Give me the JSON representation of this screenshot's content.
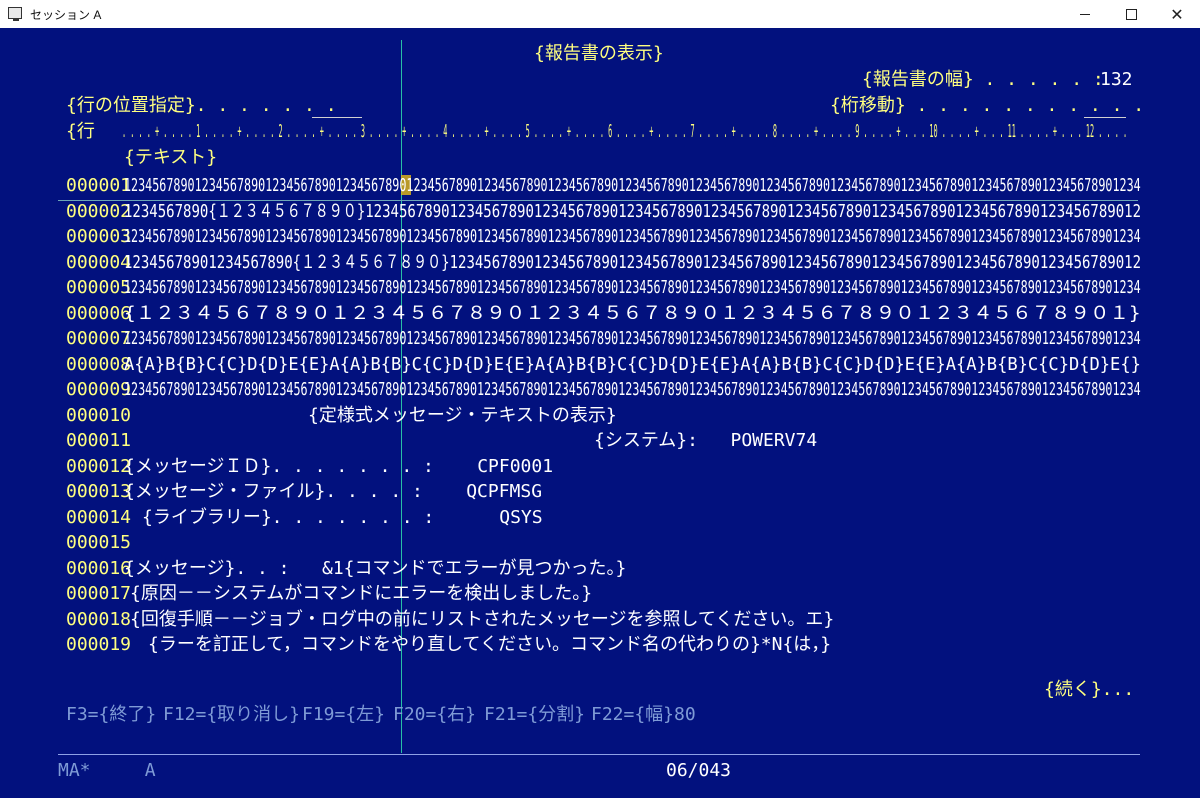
{
  "window": {
    "title": "セッション A",
    "minimize": "–",
    "maximize": "□",
    "close": "✕"
  },
  "screen": {
    "title": "{報告書の表示}",
    "report_width_label": "{報告書の幅} . . . . . :",
    "report_width_value": "132",
    "line_position_label": "{行の位置指定}. . . . . . .",
    "column_shift_label": "{桁移動} . . . . . . . . . . .",
    "ruler_label": "{行",
    "ruler": ". . . . + . . . . 1 . . . . + . . . . 2 . . . . + . . . . 3 . . . . + . . . . 4 . . . . + . . . . 5 . . . . + . . . . 6 . . . . + . . . . 7 . . . . + . . . . 8 . . . . + . . . . 9 . . . . + . . . 10 . . . . + . . . 11 . . . . + . . . 12 . . . .",
    "text_header": "{テキスト}",
    "lines": [
      {
        "num": "000001",
        "text": "123456789012345678901234567890123456789012345678901234567890123456789012345678901234567890123456789012345678901234567890123456789012345678901234"
      },
      {
        "num": "000002",
        "text": "1234567890{１２３４５６７８９０}12345678901234567890123456789012345678901234567890123456789012345678901234567890123456789012"
      },
      {
        "num": "000003",
        "text": "123456789012345678901234567890123456789012345678901234567890123456789012345678901234567890123456789012345678901234567890123456789012345678901234"
      },
      {
        "num": "000004",
        "text": "12345678901234567890{１２３４５６７８９０}1234567890123456789012345678901234567890123456789012345678901234567890123456789012"
      },
      {
        "num": "000005",
        "text": "123456789012345678901234567890123456789012345678901234567890123456789012345678901234567890123456789012345678901234567890123456789012345678901234"
      },
      {
        "num": "000006",
        "text": "{１２３４５６７８９０１２３４５６７８９０１２３４５６７８９０１２３４５６７８９０１２３４５６７８９０１}"
      },
      {
        "num": "000007",
        "text": "123456789012345678901234567890123456789012345678901234567890123456789012345678901234567890123456789012345678901234567890123456789012345678901234"
      },
      {
        "num": "000008",
        "text": "A{A}B{B}C{C}D{D}E{E}A{A}B{B}C{C}D{D}E{E}A{A}B{B}C{C}D{D}E{E}A{A}B{B}C{C}D{D}E{E}A{A}B{B}C{C}D{D}E{}"
      },
      {
        "num": "000009",
        "text": "123456789012345678901234567890123456789012345678901234567890123456789012345678901234567890123456789012345678901234567890123456789012345678901234"
      },
      {
        "num": "000010",
        "text": "{定様式メッセージ・テキストの表示}"
      },
      {
        "num": "000011",
        "text": "{システム}:   POWERV74"
      },
      {
        "num": "000012",
        "text": "{メッセージＩＤ}. . . . . . . :    CPF0001"
      },
      {
        "num": "000013",
        "text": "{メッセージ・ファイル}. . . . :    QCPFMSG"
      },
      {
        "num": "000014",
        "text": "{ライブラリー}. . . . . . . :      QSYS"
      },
      {
        "num": "000015",
        "text": ""
      },
      {
        "num": "000016",
        "text": "{メッセージ}. . :   &1{コマンドでエラーが見つかった。}"
      },
      {
        "num": "000017",
        "text": "{原因－－システムがコマンドにエラーを検出しました。}"
      },
      {
        "num": "000018",
        "text": "{回復手順－－ジョブ・ログ中の前にリストされたメッセージを参照してください。エ}"
      },
      {
        "num": "000019",
        "text": "{ラーを訂正して，コマンドをやり直してください。コマンド名の代わりの}*N{は，}"
      }
    ],
    "more": "{続く}...",
    "fkeys": [
      "F3={終了}",
      "F12={取り消し}",
      "F19={左}",
      "F20={右}",
      "F21={分割}",
      "F22={幅}80"
    ]
  },
  "status": {
    "left": "MA*     A",
    "position": "06/043"
  },
  "colors": {
    "background": "#02117e",
    "text": "#ffffff",
    "highlight": "#ffff80",
    "fkey": "#7f9bd6",
    "cursor": "#27c0a6"
  }
}
